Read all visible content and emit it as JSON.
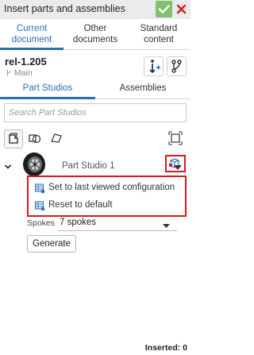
{
  "header": {
    "title": "Insert parts and assemblies",
    "accent_color": "#7fc26b",
    "close_color": "#cc2020"
  },
  "tabs": [
    {
      "label_line1": "Current",
      "label_line2": "document",
      "active": true
    },
    {
      "label_line1": "Other",
      "label_line2": "documents",
      "active": false
    },
    {
      "label_line1": "Standard",
      "label_line2": "content",
      "active": false
    }
  ],
  "document": {
    "name": "rel-1.205",
    "branch": "Main"
  },
  "subtabs": [
    {
      "label": "Part Studios",
      "active": true
    },
    {
      "label": "Assemblies",
      "active": false
    }
  ],
  "search": {
    "placeholder": "Search Part Studios"
  },
  "filters": [
    "part-filter-icon",
    "surface-filter-icon",
    "curve-filter-icon"
  ],
  "part_studio": {
    "name": "Part Studio 1"
  },
  "config_menu": {
    "items": [
      {
        "label": "Set to last viewed configuration",
        "icon": "configuration-icon"
      },
      {
        "label": "Reset to default",
        "icon": "configuration-icon"
      }
    ]
  },
  "configuration": {
    "label": "Spokes",
    "value": "7 spokes"
  },
  "generate_label": "Generate",
  "footer": {
    "inserted": "Inserted: 0"
  },
  "highlight_color": "#d7191c",
  "active_color": "#2a6db8"
}
